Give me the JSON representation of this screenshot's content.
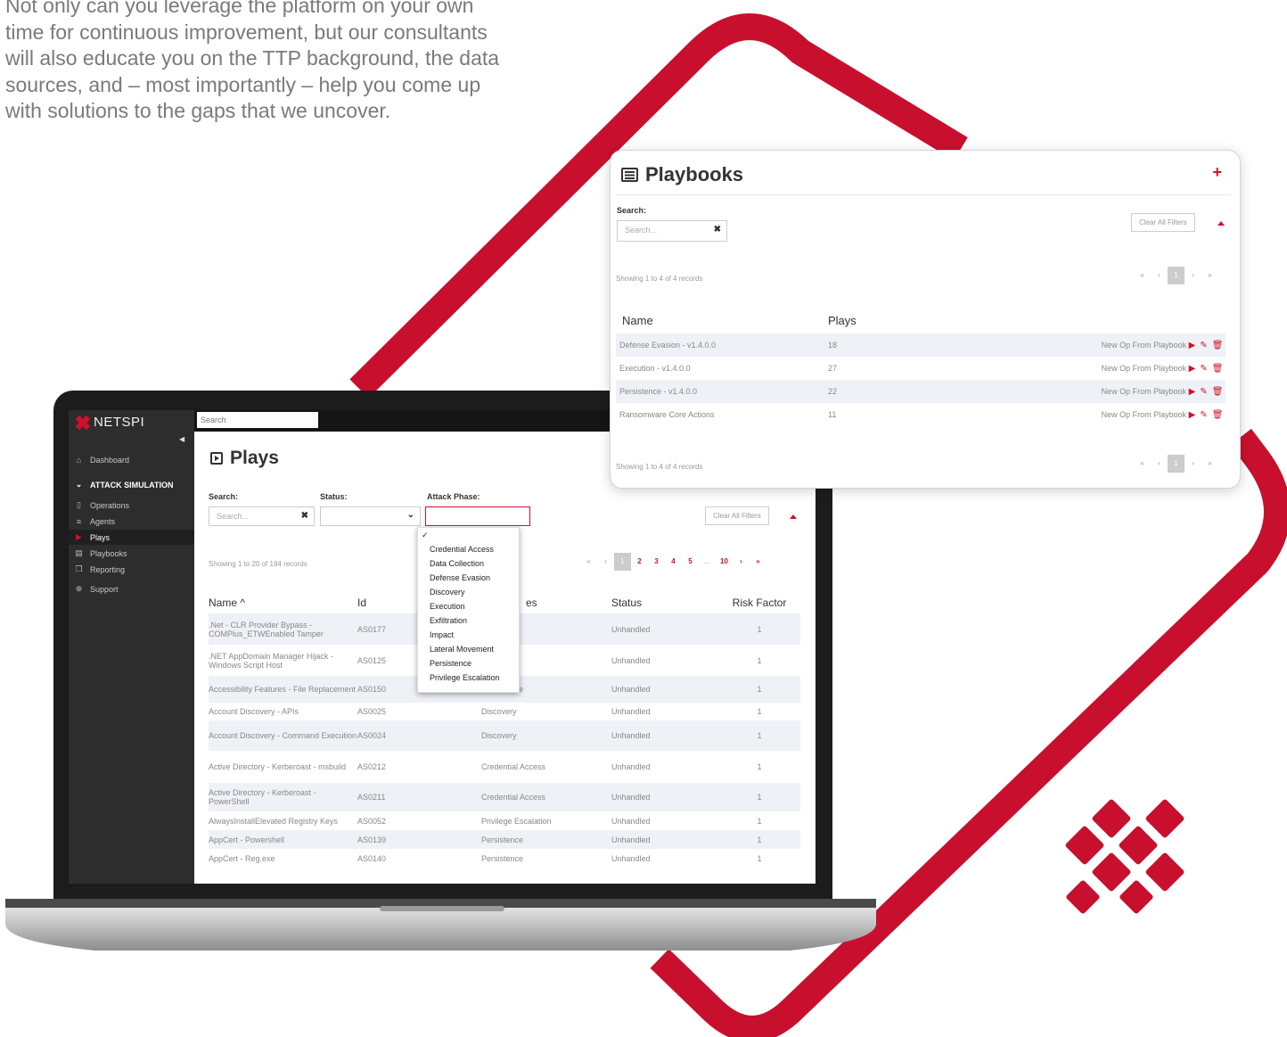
{
  "intro_text": "Not only can you leverage the platform on your own time for continuous improvement, but our consultants will also educate you on the TTP background, the data sources, and – most importantly – help you come up with solutions to the gaps that we uncover.",
  "colors": {
    "brand_red": "#d0112b",
    "sidebar_bg": "#2d2d2d",
    "row_alt": "#eef1f6"
  },
  "app": {
    "logo_text": "NETSPI",
    "top_search_placeholder": "Search",
    "sidebar": {
      "dashboard": {
        "label": "Dashboard",
        "icon": "home-icon"
      },
      "section_header": {
        "label": "ATTACK SIMULATION",
        "icon": "chevron-down-circle-icon"
      },
      "items": [
        {
          "label": "Operations",
          "icon": "map-icon"
        },
        {
          "label": "Agents",
          "icon": "list-icon"
        },
        {
          "label": "Plays",
          "icon": "play-icon"
        },
        {
          "label": "Playbooks",
          "icon": "book-icon"
        },
        {
          "label": "Reporting",
          "icon": "copy-icon"
        }
      ],
      "support": {
        "label": "Support",
        "icon": "life-ring-icon"
      }
    },
    "plays": {
      "title": "Plays",
      "search_label": "Search:",
      "search_placeholder": "Search...",
      "status_label": "Status:",
      "attack_phase_label": "Attack Phase:",
      "clear_filters": "Clear All Filters",
      "records_text": "Showing 1 to 20 of 194 records",
      "pager": {
        "first": "«",
        "prev": "‹",
        "pages": [
          "1",
          "2",
          "3",
          "4",
          "5"
        ],
        "ellipsis": "...",
        "last_page": "10",
        "next": "›",
        "last": "»"
      },
      "columns": {
        "name": "Name ^",
        "id": "Id",
        "phases": "es",
        "status": "Status",
        "risk": "Risk Factor"
      },
      "rows": [
        {
          "name": ".Net - CLR Provider Bypass - COMPlus_ETWEnabled Tamper",
          "id": "AS0177",
          "phase": "",
          "status": "Unhandled",
          "risk": "1"
        },
        {
          "name": ".NET AppDomain Manager Hijack - Windows Script Host",
          "id": "AS0125",
          "phase": "",
          "status": "Unhandled",
          "risk": "1"
        },
        {
          "name": "Accessibility Features - File Replacement",
          "id": "AS0150",
          "phase": "Persistence",
          "status": "Unhandled",
          "risk": "1"
        },
        {
          "name": "Account Discovery - APIs",
          "id": "AS0025",
          "phase": "Discovery",
          "status": "Unhandled",
          "risk": "1"
        },
        {
          "name": "Account Discovery - Command Execution",
          "id": "AS0024",
          "phase": "Discovery",
          "status": "Unhandled",
          "risk": "1"
        },
        {
          "name": "Active Directory - Kerberoast - msbuild",
          "id": "AS0212",
          "phase": "Credential Access",
          "status": "Unhandled",
          "risk": "1"
        },
        {
          "name": "Active Directory - Kerberoast - PowerShell",
          "id": "AS0211",
          "phase": "Credential Access",
          "status": "Unhandled",
          "risk": "1"
        },
        {
          "name": "AlwaysInstallElevated Registry Keys",
          "id": "AS0052",
          "phase": "Privilege Escalation",
          "status": "Unhandled",
          "risk": "1"
        },
        {
          "name": "AppCert - Powershell",
          "id": "AS0139",
          "phase": "Persistence",
          "status": "Unhandled",
          "risk": "1"
        },
        {
          "name": "AppCert - Reg.exe",
          "id": "AS0140",
          "phase": "Persistence",
          "status": "Unhandled",
          "risk": "1"
        }
      ],
      "phase_dropdown": {
        "selected": "✓",
        "options": [
          "Credential Access",
          "Data Collection",
          "Defense Evasion",
          "Discovery",
          "Execution",
          "Exfiltration",
          "Impact",
          "Lateral Movement",
          "Persistence",
          "Privilege Escalation"
        ]
      }
    }
  },
  "playbooks": {
    "title": "Playbooks",
    "add_icon": "plus-icon",
    "search_label": "Search:",
    "search_placeholder": "Search...",
    "clear_filters": "Clear All Filters",
    "records_top": "Showing 1 to 4 of 4 records",
    "records_bottom": "Showing 1 to 4 of 4 records",
    "pager": {
      "first": "«",
      "prev": "‹",
      "page": "1",
      "next": "›",
      "last": "»"
    },
    "columns": {
      "name": "Name",
      "plays": "Plays"
    },
    "action_label": "New Op From Playbook",
    "rows": [
      {
        "name": "Defense Evasion - v1.4.0.0",
        "plays": "18"
      },
      {
        "name": "Execution - v1.4.0.0",
        "plays": "27"
      },
      {
        "name": "Persistence - v1.4.0.0",
        "plays": "22"
      },
      {
        "name": "Ransomware Core Actions",
        "plays": "11"
      }
    ]
  }
}
